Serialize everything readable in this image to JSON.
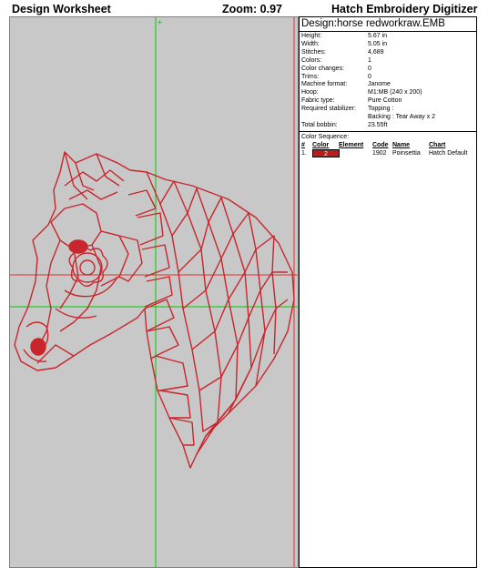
{
  "header": {
    "title": "Design Worksheet",
    "zoom": "Zoom:  0.97",
    "product": "Hatch Embroidery Digitizer"
  },
  "info": {
    "design_title": "Design:horse redworkraw.EMB",
    "properties": [
      {
        "key": "Height:",
        "value": "5.67 in"
      },
      {
        "key": "Width:",
        "value": "5.05 in"
      },
      {
        "key": "Stitches:",
        "value": "4,689"
      },
      {
        "key": "Colors:",
        "value": "1"
      },
      {
        "key": "Color changes:",
        "value": "0"
      },
      {
        "key": "Trims:",
        "value": "0"
      },
      {
        "key": "Machine format:",
        "value": "Janome"
      },
      {
        "key": "Hoop:",
        "value": "M1:MB (240 x 200)"
      },
      {
        "key": "Fabric type:",
        "value": "Pure Cotton"
      },
      {
        "key": "Required stabilizer:",
        "value": "Topping :"
      },
      {
        "key": "",
        "value": "Backing : Tear Away x 2"
      },
      {
        "key": "Total bobbin:",
        "value": "23.55ft"
      }
    ]
  },
  "sequence": {
    "title": "Color Sequence:",
    "headers": {
      "idx": "#",
      "color": "Color",
      "element": "Element",
      "code": "Code",
      "name": "Name",
      "chart": "Chart"
    },
    "rows": [
      {
        "idx": "1.",
        "color_num": "2",
        "element": "",
        "code": "1902",
        "name": "Poinsettia",
        "chart": "Hatch Default",
        "swatch": "#b81c1c"
      }
    ]
  },
  "colors": {
    "thread": "#c8262c",
    "canvas_bg": "#c8c8c8",
    "guide": "#00cc00",
    "hoop_line": "#e03030"
  },
  "icons": [
    "center-cross-icon"
  ]
}
